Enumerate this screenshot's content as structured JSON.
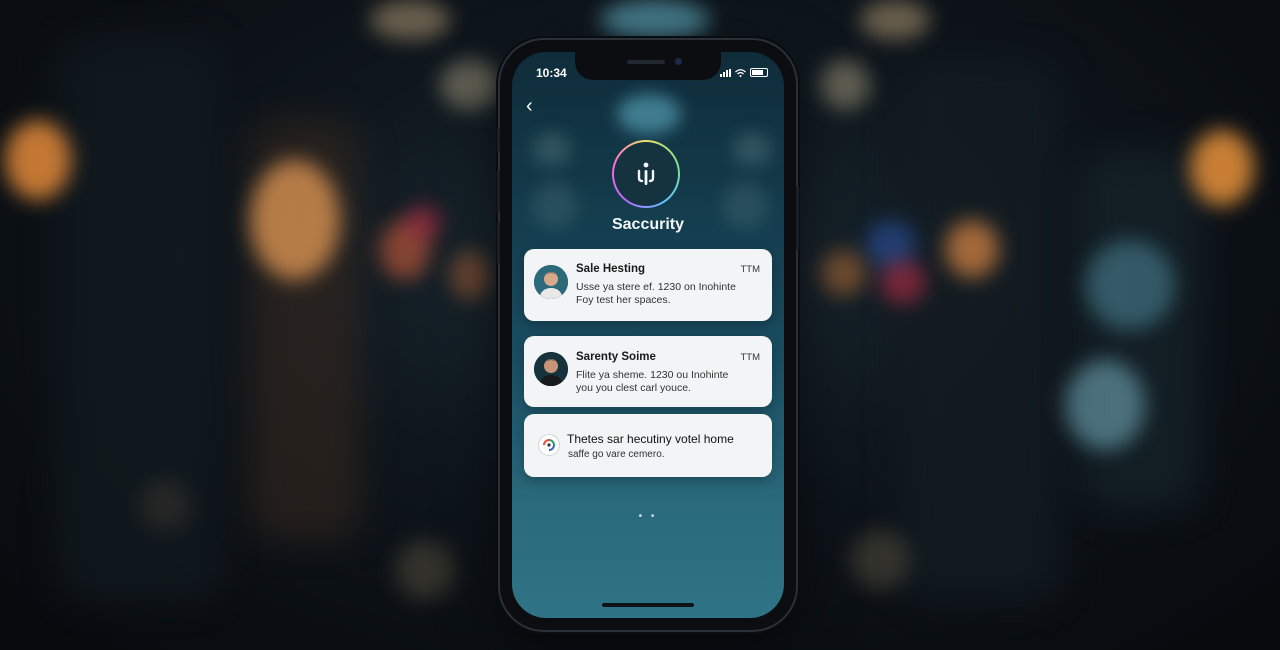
{
  "status_bar": {
    "time": "10:34"
  },
  "header": {
    "back_label": "‹",
    "app_title": "Saccurity"
  },
  "notifications": [
    {
      "title": "Sale Hesting",
      "time": "TTM",
      "line1": "Usse ya stere ef. 1230 on Inohinte",
      "line2": "Foy test her spaces."
    },
    {
      "title": "Sarenty Soime",
      "time": "TTM",
      "line1": "Flite ya sheme. 1230 ou Inohinte",
      "line2": "you you clest carl youce."
    },
    {
      "title": "Thetes sar hecutiny votel home",
      "line1": "saffe go vare cemero."
    }
  ],
  "pager": {
    "dots": "• •"
  },
  "colors": {
    "screen_top": "#0f2c3a",
    "screen_bottom": "#2f7486",
    "card_bg": "#f3f4f5"
  }
}
